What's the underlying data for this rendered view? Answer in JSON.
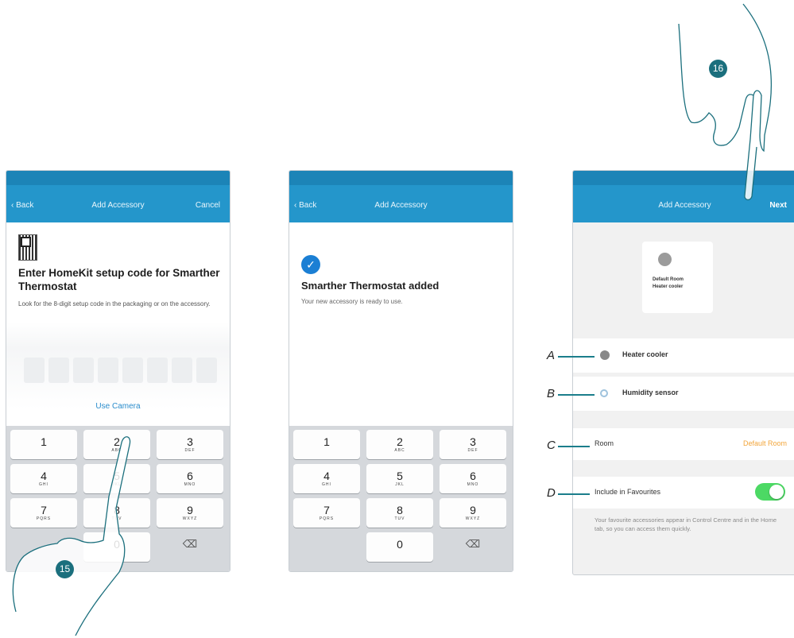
{
  "phone1": {
    "nav_back": "‹ Back",
    "nav_title": "Add Accessory",
    "nav_cancel": "Cancel",
    "title": "Enter HomeKit setup code for Smarther Thermostat",
    "description": "Look for the 8-digit setup code in the packaging or on the accessory.",
    "use_camera": "Use Camera"
  },
  "phone2": {
    "nav_back": "‹ Back",
    "nav_title": "Add Accessory",
    "title": "Smarther Thermostat added",
    "description": "Your new accessory is ready to use."
  },
  "phone3": {
    "nav_title": "Add Accessory",
    "nav_next": "Next",
    "tile_room": "Default Room",
    "tile_name": "Heater cooler",
    "row_heater": "Heater cooler",
    "row_humidity": "Humidity sensor",
    "row_room": "Room",
    "row_room_value": "Default Room",
    "row_favourites": "Include in Favourites",
    "favourites_on": true,
    "favourites_note": "Your favourite accessories appear in Control Centre and in the Home tab, so you can access them quickly."
  },
  "keypad": {
    "keys": [
      {
        "digit": "1",
        "letters": ""
      },
      {
        "digit": "2",
        "letters": "ABC"
      },
      {
        "digit": "3",
        "letters": "DEF"
      },
      {
        "digit": "4",
        "letters": "GHI"
      },
      {
        "digit": "5",
        "letters": "JKL"
      },
      {
        "digit": "6",
        "letters": "MNO"
      },
      {
        "digit": "7",
        "letters": "PQRS"
      },
      {
        "digit": "8",
        "letters": "TUV"
      },
      {
        "digit": "9",
        "letters": "WXYZ"
      },
      {
        "digit": "0",
        "letters": ""
      }
    ],
    "delete_glyph": "⌫"
  },
  "callouts": [
    "A",
    "B",
    "C",
    "D"
  ],
  "steps": [
    "15",
    "16"
  ],
  "colors": {
    "nav_blue": "#2496cb",
    "step_teal": "#1b6f7d",
    "toggle_green": "#4cd964",
    "room_orange": "#f2a53a",
    "check_blue": "#1b7fd4"
  }
}
